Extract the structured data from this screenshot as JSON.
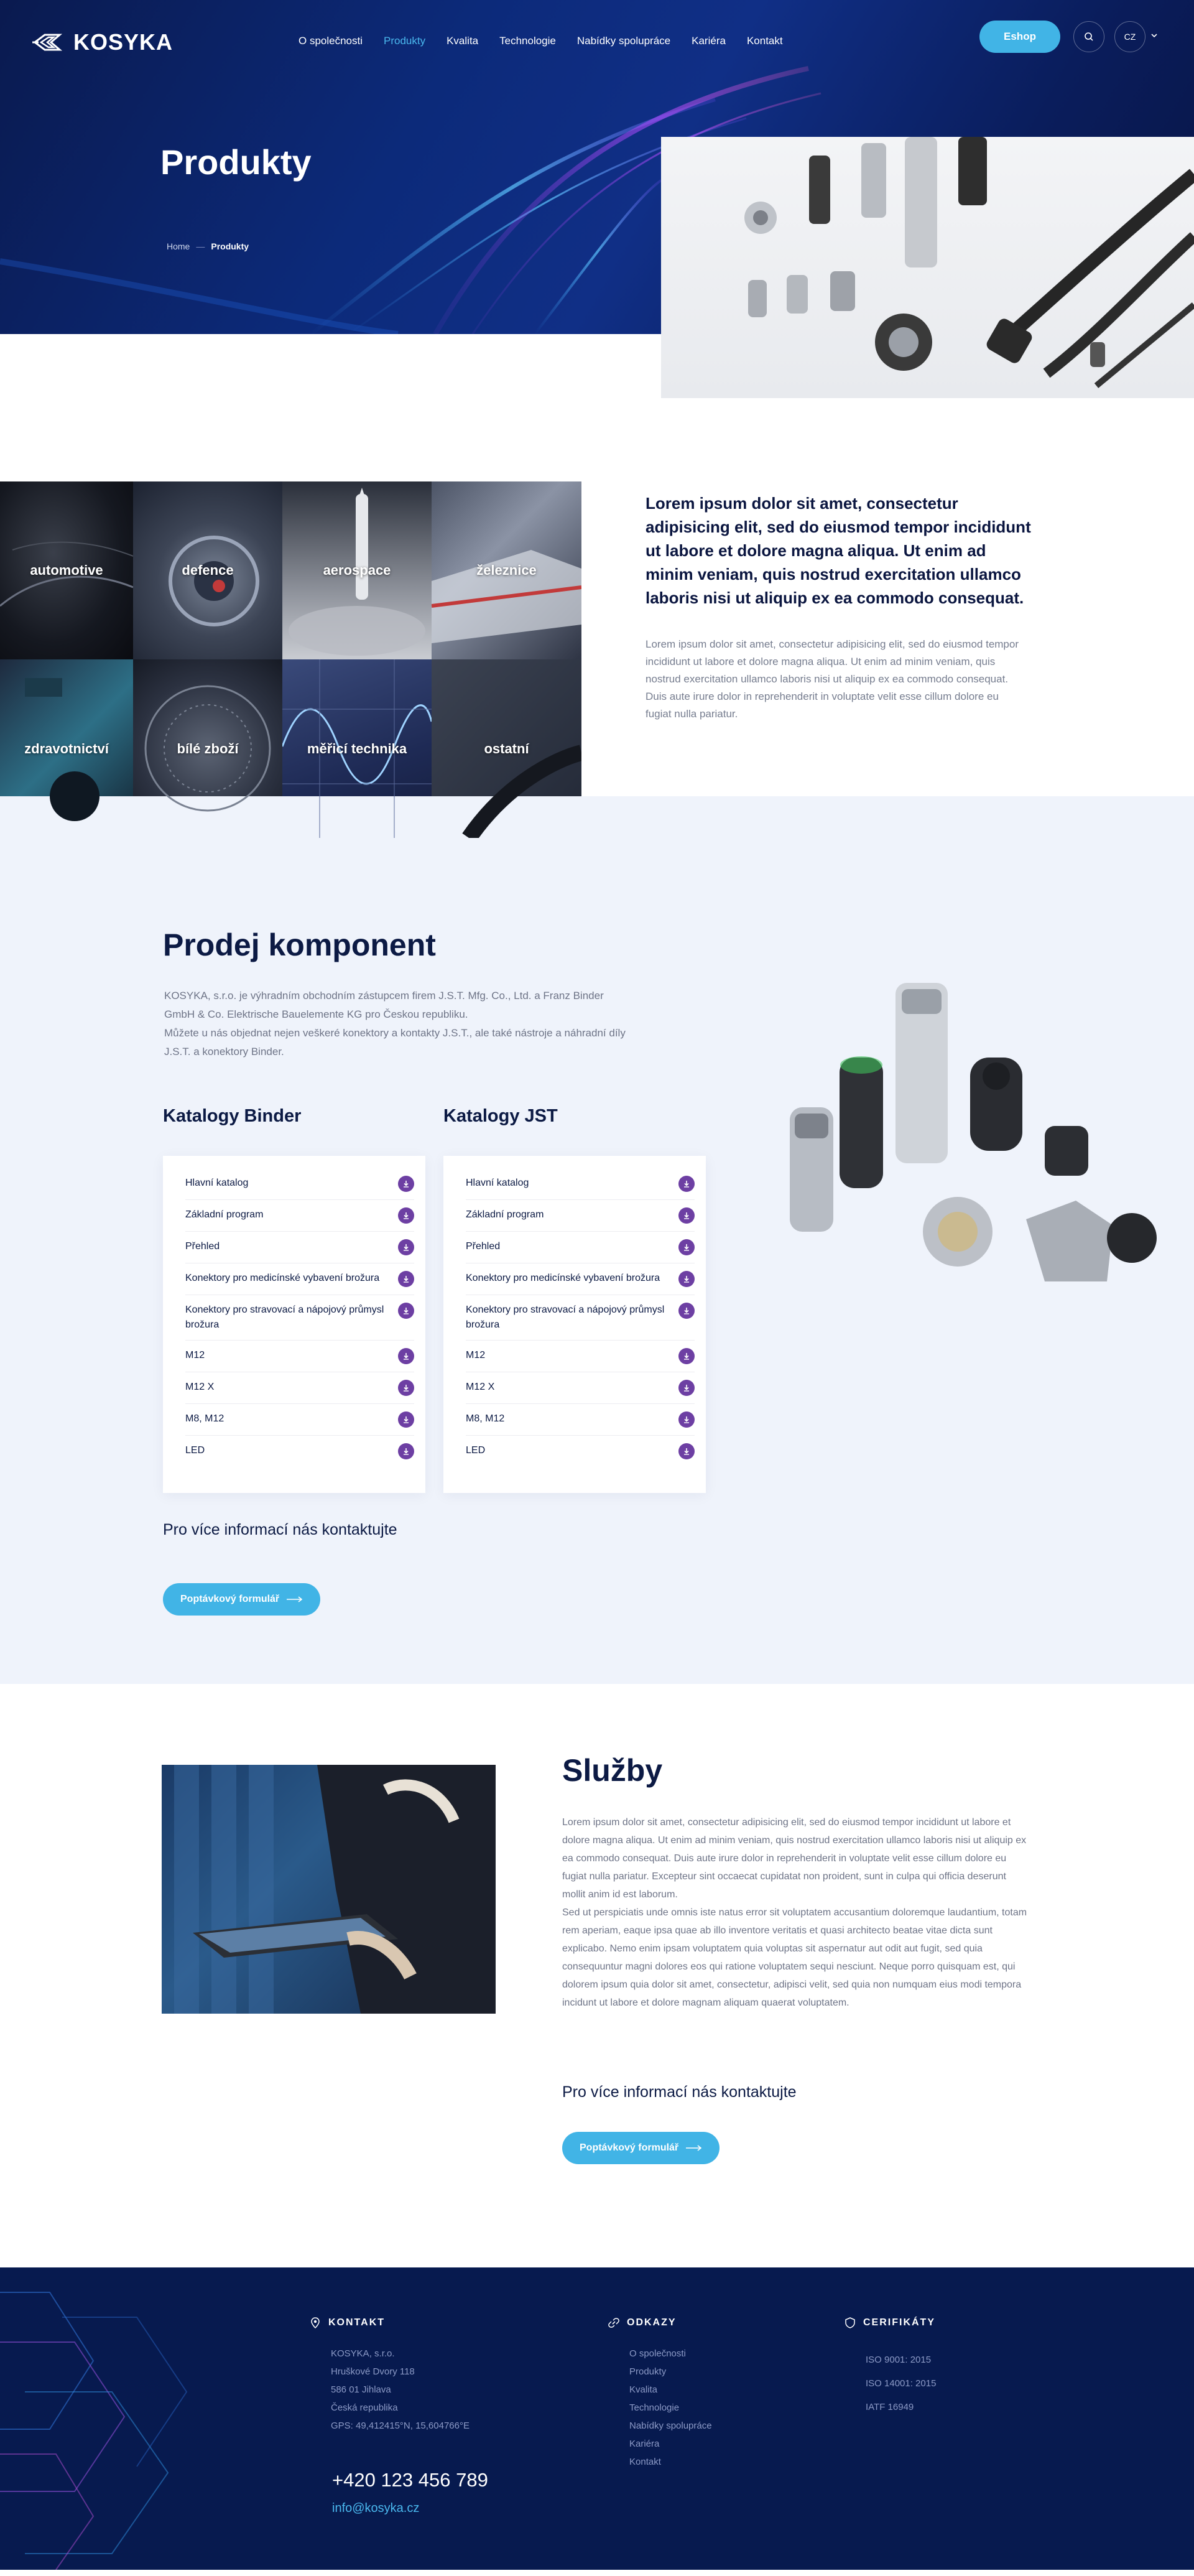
{
  "header": {
    "logo_text": "KOSYKA",
    "nav": [
      {
        "label": "O společnosti",
        "active": false
      },
      {
        "label": "Produkty",
        "active": true
      },
      {
        "label": "Kvalita",
        "active": false
      },
      {
        "label": "Technologie",
        "active": false
      },
      {
        "label": "Nabídky spolupráce",
        "active": false
      },
      {
        "label": "Kariéra",
        "active": false
      },
      {
        "label": "Kontakt",
        "active": false
      }
    ],
    "eshop_label": "Eshop",
    "search_icon": "search-icon",
    "language": "CZ",
    "language_chevron_icon": "chevron-down-icon"
  },
  "hero": {
    "title": "Produkty",
    "breadcrumb": {
      "home": "Home",
      "separator": "—",
      "current": "Produkty"
    }
  },
  "categories": [
    {
      "label": "automotive"
    },
    {
      "label": "defence"
    },
    {
      "label": "aerospace"
    },
    {
      "label": "železnice"
    },
    {
      "label": "zdravotnictví"
    },
    {
      "label": "bílé zboží"
    },
    {
      "label": "měřicí technika"
    },
    {
      "label": "ostatní"
    }
  ],
  "intro": {
    "lead": "Lorem ipsum dolor sit amet, consectetur adipisicing elit, sed do eiusmod tempor incididunt ut labore et dolore magna aliqua. Ut enim ad minim veniam, quis nostrud exercitation ullamco laboris nisi ut aliquip ex ea commodo consequat.",
    "body": "Lorem ipsum dolor sit amet, consectetur adipisicing elit, sed do eiusmod tempor incididunt ut labore et dolore magna aliqua. Ut enim ad minim veniam, quis nostrud exercitation ullamco laboris nisi ut aliquip ex ea commodo consequat. Duis aute irure dolor in reprehenderit in voluptate velit esse cillum dolore eu fugiat nulla pariatur."
  },
  "prodej": {
    "title": "Prodej komponent",
    "desc_line1": "KOSYKA, s.r.o. je výhradním obchodním zástupcem firem J.S.T. Mfg. Co., Ltd. a Franz Binder GmbH & Co. Elektrische Bauelemente KG pro Českou republiku.",
    "desc_line2": "Můžete u nás objednat nejen veškeré konektory a kontakty J.S.T., ale také nástroje a náhradní díly J.S.T. a konektory Binder.",
    "binder_title": "Katalogy Binder",
    "jst_title": "Katalogy JST",
    "binder_items": [
      "Hlavní katalog",
      "Základní program",
      "Přehled",
      "Konektory pro medicínské vybavení brožura",
      "Konektory pro stravovací a nápojový průmysl brožura",
      "M12",
      "M12 X",
      "M8, M12",
      "LED"
    ],
    "jst_items": [
      "Hlavní katalog",
      "Základní program",
      "Přehled",
      "Konektory pro medicínské vybavení brožura",
      "Konektory pro stravovací a nápojový průmysl brožura",
      "M12",
      "M12 X",
      "M8, M12",
      "LED"
    ],
    "download_icon": "download-icon",
    "contact_note": "Pro více informací nás kontaktujte",
    "button_label": "Poptávkový formulář",
    "button_icon": "arrow-right-icon"
  },
  "sluzby": {
    "title": "Služby",
    "body_p1": "Lorem ipsum dolor sit amet, consectetur adipisicing elit, sed do eiusmod tempor incididunt ut labore et dolore magna aliqua. Ut enim ad minim veniam, quis nostrud exercitation ullamco laboris nisi ut aliquip ex ea commodo consequat. Duis aute irure dolor in reprehenderit in voluptate velit esse cillum dolore eu fugiat nulla pariatur. Excepteur sint occaecat cupidatat non proident, sunt in culpa qui officia deserunt mollit anim id est laborum.",
    "body_p2": "Sed ut perspiciatis unde omnis iste natus error sit voluptatem accusantium doloremque laudantium, totam rem aperiam, eaque ipsa quae ab illo inventore veritatis et quasi architecto beatae vitae dicta sunt explicabo. Nemo enim ipsam voluptatem quia voluptas sit aspernatur aut odit aut fugit, sed quia consequuntur magni dolores eos qui ratione voluptatem sequi nesciunt. Neque porro quisquam est, qui dolorem ipsum quia dolor sit amet, consectetur, adipisci velit, sed quia non numquam eius modi tempora incidunt ut labore et dolore magnam aliquam quaerat voluptatem.",
    "contact_note": "Pro více informací nás kontaktujte",
    "button_label": "Poptávkový formulář"
  },
  "footer": {
    "kontakt": {
      "heading": "KONTAKT",
      "icon": "map-pin-icon",
      "lines": [
        "KOSYKA, s.r.o.",
        "Hruškové Dvory 118",
        "586 01 Jihlava",
        "Česká republika",
        "GPS: 49,412415°N, 15,604766°E"
      ],
      "phone": "+420 123 456 789",
      "email": "info@kosyka.cz"
    },
    "odkazy": {
      "heading": "ODKAZY",
      "icon": "link-icon",
      "links": [
        "O společnosti",
        "Produkty",
        "Kvalita",
        "Technologie",
        "Nabídky spolupráce",
        "Kariéra",
        "Kontakt"
      ]
    },
    "certifikaty": {
      "heading": "CERIFIKÁTY",
      "icon": "shield-icon",
      "items": [
        "ISO 9001: 2015",
        "ISO 14001: 2015",
        "IATF 16949"
      ]
    }
  },
  "colors": {
    "navy": "#0c1a44",
    "accent_blue": "#41b4e6",
    "download_purple": "#6d3fa3",
    "section_bg": "#eff3fb",
    "footer_bg": "#071a4f"
  }
}
